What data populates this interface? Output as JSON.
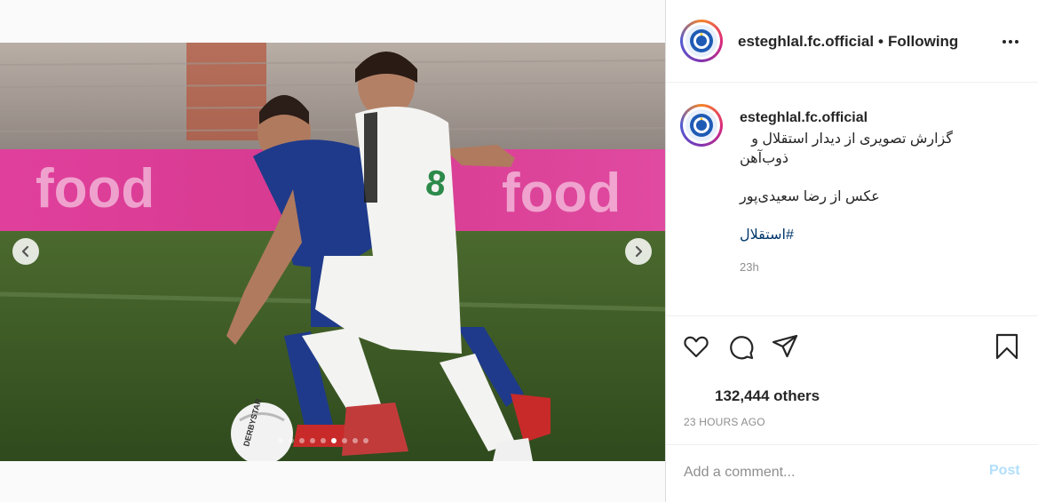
{
  "header": {
    "username": "esteghlal.fc.official",
    "separator": "•",
    "follow_status": "Following",
    "avatar_icon": "esteghlal-logo-icon",
    "more_icon": "more-options-icon"
  },
  "caption": {
    "username": "esteghlal.fc.official",
    "line1": "گزارش تصویری از دیدار استقلال و",
    "line2": "ذوب‌آهن",
    "credit": "عکس از رضا سعیدی‌پور",
    "hashtag": "#استقلال",
    "time": "23h"
  },
  "media": {
    "photo_subject": "football-match-photo",
    "carousel_total": 9,
    "carousel_active": 6,
    "prev_icon": "chevron-left-icon",
    "next_icon": "chevron-right-icon"
  },
  "actions": {
    "like_icon": "heart-icon",
    "comment_icon": "comment-icon",
    "share_icon": "share-icon",
    "save_icon": "bookmark-icon"
  },
  "likes_text": "132,444 others",
  "posted_ago": "23 HOURS AGO",
  "comment": {
    "placeholder": "Add a comment...",
    "post_label": "Post"
  },
  "colors": {
    "link": "#00376b",
    "post_button_disabled": "#b2dffc",
    "muted": "#8e8e8e"
  }
}
